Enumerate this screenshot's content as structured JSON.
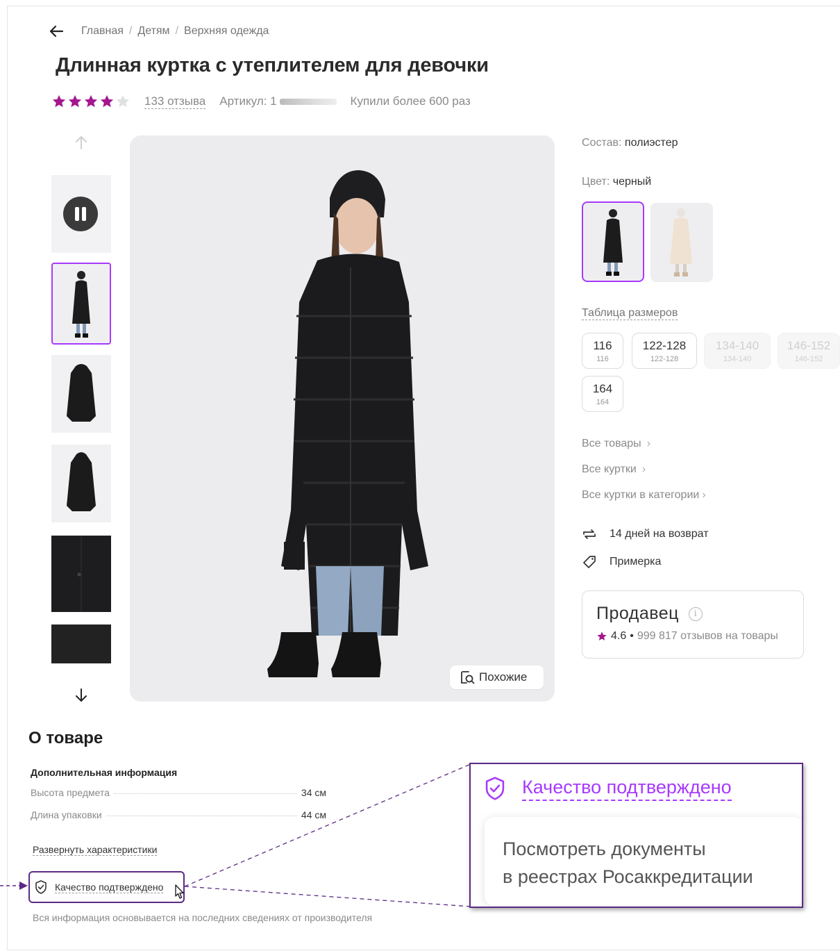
{
  "breadcrumb": {
    "items": [
      "Главная",
      "Детям",
      "Верхняя одежда"
    ],
    "separator": "/"
  },
  "product": {
    "title": "Длинная куртка с утеплителем для девочки",
    "rating": 4,
    "rating_max": 5,
    "reviews": "133 отзыва",
    "article_label": "Артикул: 1",
    "purchases": "Купили более 600 раз"
  },
  "gallery": {
    "similar_label": "Похожие"
  },
  "details": {
    "composition_label": "Состав:",
    "composition_value": "полиэстер",
    "color_label": "Цвет:",
    "color_value": "черный",
    "size_table_label": "Таблица размеров",
    "sizes": [
      {
        "main": "116",
        "sub": "116",
        "available": true
      },
      {
        "main": "122-128",
        "sub": "122-128",
        "available": true
      },
      {
        "main": "134-140",
        "sub": "134-140",
        "available": false
      },
      {
        "main": "146-152",
        "sub": "146-152",
        "available": false
      },
      {
        "main": "164",
        "sub": "164",
        "available": true
      }
    ],
    "links": [
      "Все товары",
      "Все куртки",
      "Все куртки в категории"
    ],
    "chevron": "›",
    "return_text": "14 дней на возврат",
    "fitting_text": "Примерка"
  },
  "seller": {
    "title": "Продавец",
    "info_glyph": "i",
    "rating": "4.6",
    "bullet": "•",
    "reviews": "999 817 отзывов на товары"
  },
  "about": {
    "title": "О товаре",
    "additional_info": "Дополнительная информация",
    "characteristics": [
      {
        "key": "Высота предмета",
        "value": "34 см"
      },
      {
        "key": "Длина упаковки",
        "value": "44 см"
      }
    ],
    "expand_label": "Развернуть характеристики",
    "quality_label": "Качество подтверждено",
    "disclaimer": "Вся информация основывается на последних сведениях от производителя"
  },
  "zoom": {
    "quality_label": "Качество подтверждено",
    "line1": "Посмотреть документы",
    "line2": "в реестрах Росаккредитации"
  },
  "colors": {
    "accent": "#a73afd",
    "callout_border": "#5b2a86",
    "star": "#a4168f",
    "muted_text": "#8a8a8a"
  }
}
